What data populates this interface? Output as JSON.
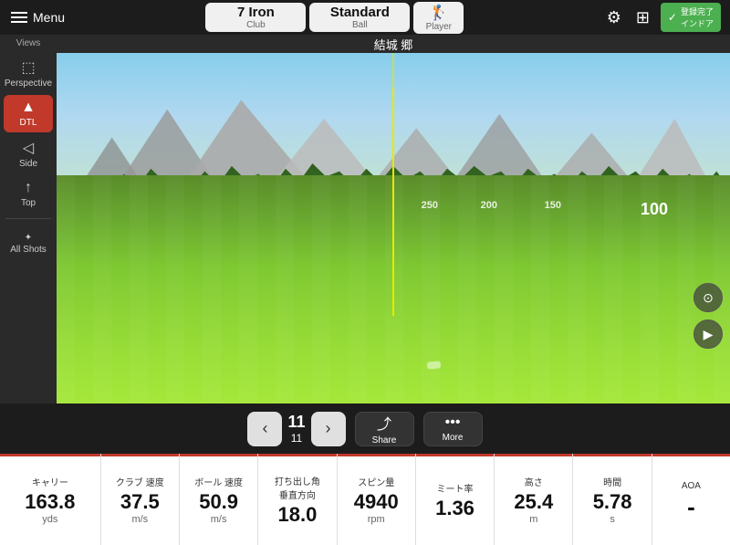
{
  "topbar": {
    "menu_label": "Menu",
    "club": {
      "name": "7 Iron",
      "sub": "Club"
    },
    "ball": {
      "name": "Standard",
      "sub": "Ball"
    },
    "player_sub": "Player",
    "player_name": "結城 郷",
    "status_label": "登録完了\nインドア"
  },
  "sidebar": {
    "views_label": "Views",
    "perspective_label": "Perspective",
    "dtl_label": "DTL",
    "side_label": "Side",
    "top_label": "Top",
    "all_shots_label": "All Shots"
  },
  "viewport": {
    "distances": [
      {
        "value": "250",
        "right_offset": "320px"
      },
      {
        "value": "200",
        "right_offset": "255px"
      },
      {
        "value": "150",
        "right_offset": "180px"
      },
      {
        "value": "100",
        "right_offset": "75px"
      }
    ]
  },
  "controls": {
    "shot_current": "11",
    "shot_total": "11",
    "share_label": "Share",
    "more_label": "More"
  },
  "stats": [
    {
      "label": "キャリー",
      "value": "163.8",
      "unit": "yds"
    },
    {
      "label": "クラブ 速度",
      "value": "37.5",
      "unit": "m/s"
    },
    {
      "label": "ボール 速度",
      "value": "50.9",
      "unit": "m/s"
    },
    {
      "label": "打ち出し角\n垂直方向",
      "value": "18.0",
      "unit": ""
    },
    {
      "label": "スピン量",
      "value": "4940",
      "unit": "rpm"
    },
    {
      "label": "ミート率",
      "value": "1.36",
      "unit": ""
    },
    {
      "label": "高さ",
      "value": "25.4",
      "unit": "m"
    },
    {
      "label": "時間",
      "value": "5.78",
      "unit": "s"
    },
    {
      "label": "AOA",
      "value": "-",
      "unit": ""
    }
  ]
}
